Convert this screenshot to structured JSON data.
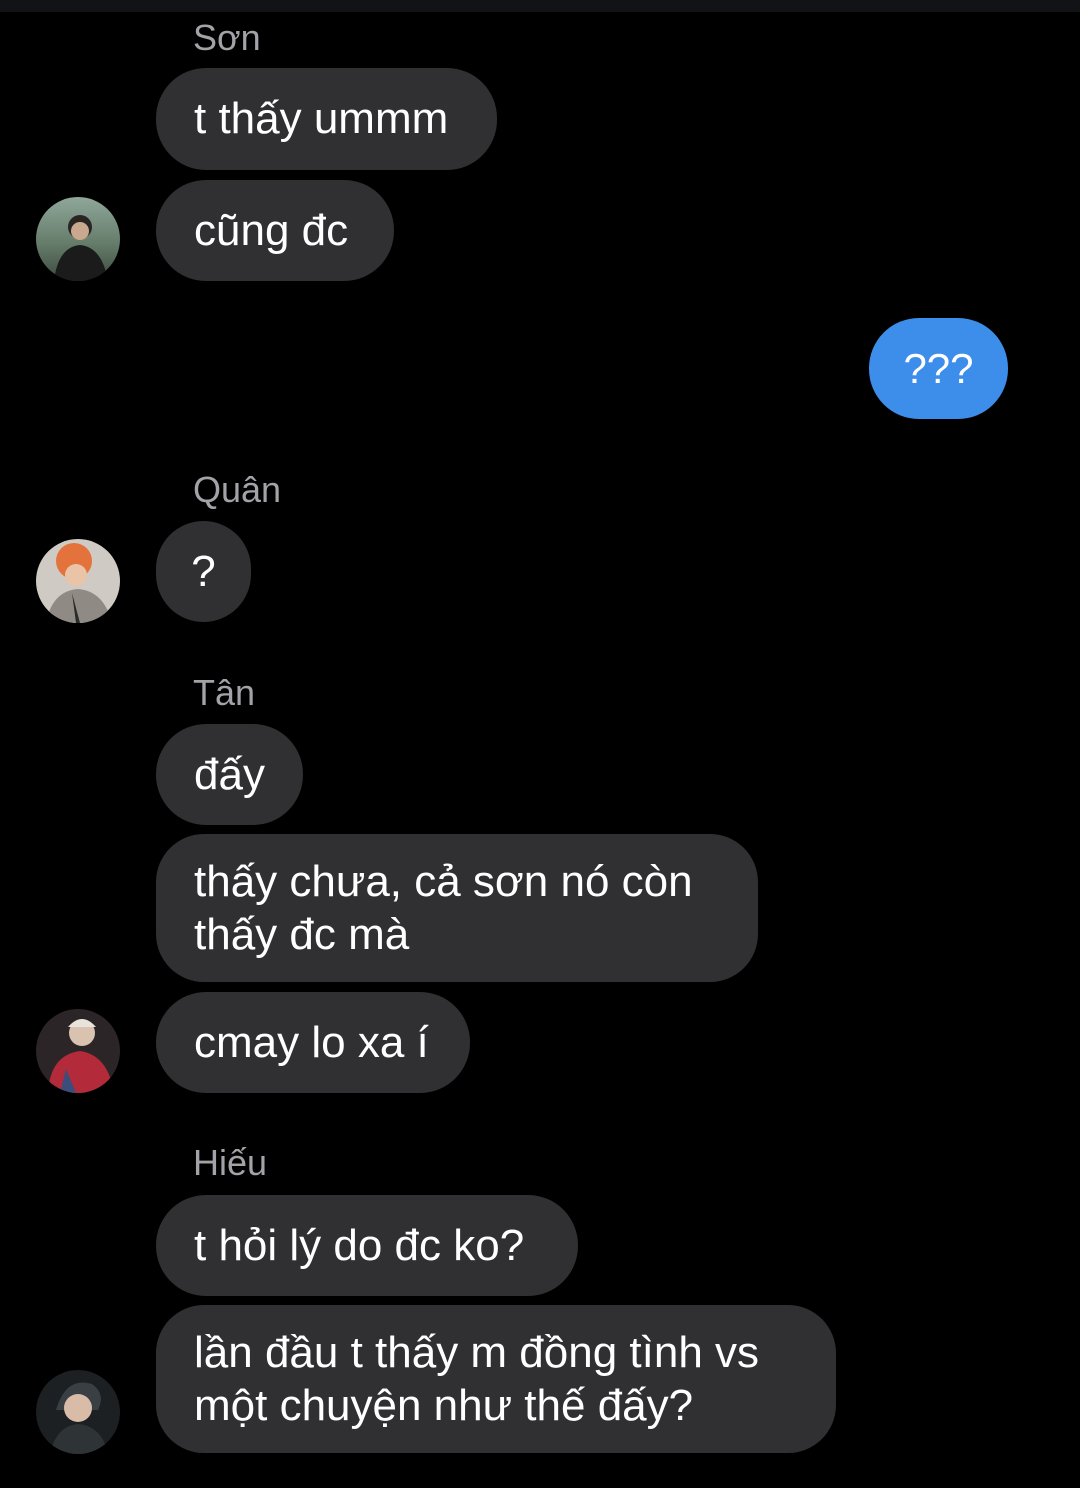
{
  "colors": {
    "background": "#000000",
    "incoming_bubble": "#303033",
    "outgoing_bubble": "#3d8eea",
    "sender_name": "#a2a2a8"
  },
  "groups": [
    {
      "sender": "Sơn",
      "messages": [
        "t thấy ummm",
        "cũng đc"
      ]
    },
    {
      "sender": "",
      "messages": [
        "???"
      ],
      "outgoing": true
    },
    {
      "sender": "Quân",
      "messages": [
        "?"
      ]
    },
    {
      "sender": "Tân",
      "messages": [
        "đấy",
        "thấy chưa, cả sơn nó còn thấy đc mà",
        "cmay lo xa í"
      ]
    },
    {
      "sender": "Hiếu",
      "messages": [
        "t hỏi lý do đc ko?",
        "lần đầu t thấy m đồng tình vs một chuyện như thế đấy?"
      ]
    }
  ],
  "avatars": [
    {
      "name": "Sơn",
      "icon": "avatar-photo"
    },
    {
      "name": "Quân",
      "icon": "avatar-photo"
    },
    {
      "name": "Tân",
      "icon": "avatar-photo"
    },
    {
      "name": "Hiếu",
      "icon": "avatar-photo"
    }
  ]
}
